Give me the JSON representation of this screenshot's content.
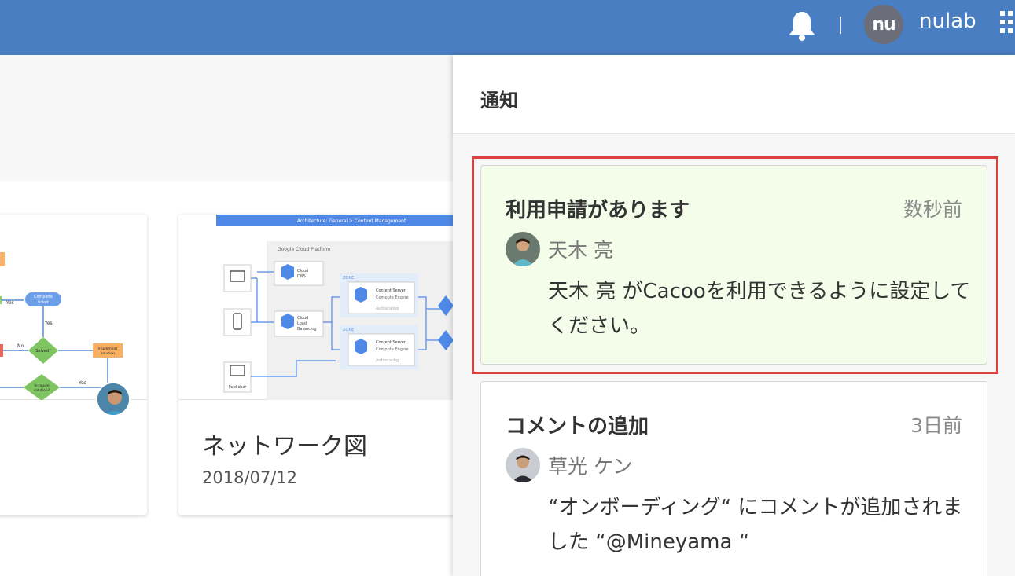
{
  "topbar": {
    "bell_icon": "bell-icon",
    "user_avatar_text": "nu",
    "username": "nulab",
    "apps_icon": "apps-grid-icon",
    "color": "#4a7ec2"
  },
  "cards": [
    {
      "title": "",
      "date": "",
      "thumbnail_text": {
        "node_complete": "Complete ticket",
        "node_implement": "Implement solution",
        "node_solved": "Solved?",
        "node_inhouse": "In-house solution?",
        "yes1": "Yes",
        "yes2": "Yes",
        "yes3": "Yes",
        "no1": "No"
      }
    },
    {
      "title": "ネットワーク図",
      "date": "2018/07/12",
      "thumbnail_text": {
        "banner": "Architecture: General > Content Management",
        "gcp": "Google Cloud Platform",
        "dns_1": "Cloud",
        "dns_2": "DNS",
        "lb_1": "Cloud",
        "lb_2": "Load",
        "lb_3": "Balancing",
        "zone1": "ZONE",
        "zone2": "ZONE",
        "cs1_title": "Content Server",
        "cs1_sub": "Compute Engine",
        "cs1_auto": "Autoscaling",
        "cs2_title": "Content Server",
        "cs2_sub": "Compute Engine",
        "cs2_auto": "Autoscaling",
        "publisher": "Publisher"
      }
    }
  ],
  "panel": {
    "title": "通知",
    "notifications": [
      {
        "title": "利用申請があります",
        "time": "数秒前",
        "user": "天木 亮",
        "message": "天木 亮 がCacooを利用できるように設定してください。",
        "bg": "#f4fde9",
        "highlight": "#dc4040"
      },
      {
        "title": "コメントの追加",
        "time": "3日前",
        "user": "草光 ケン",
        "message": "“オンボーディング“ にコメントが追加されました “@Mineyama “",
        "bg": "#ffffff"
      }
    ]
  }
}
